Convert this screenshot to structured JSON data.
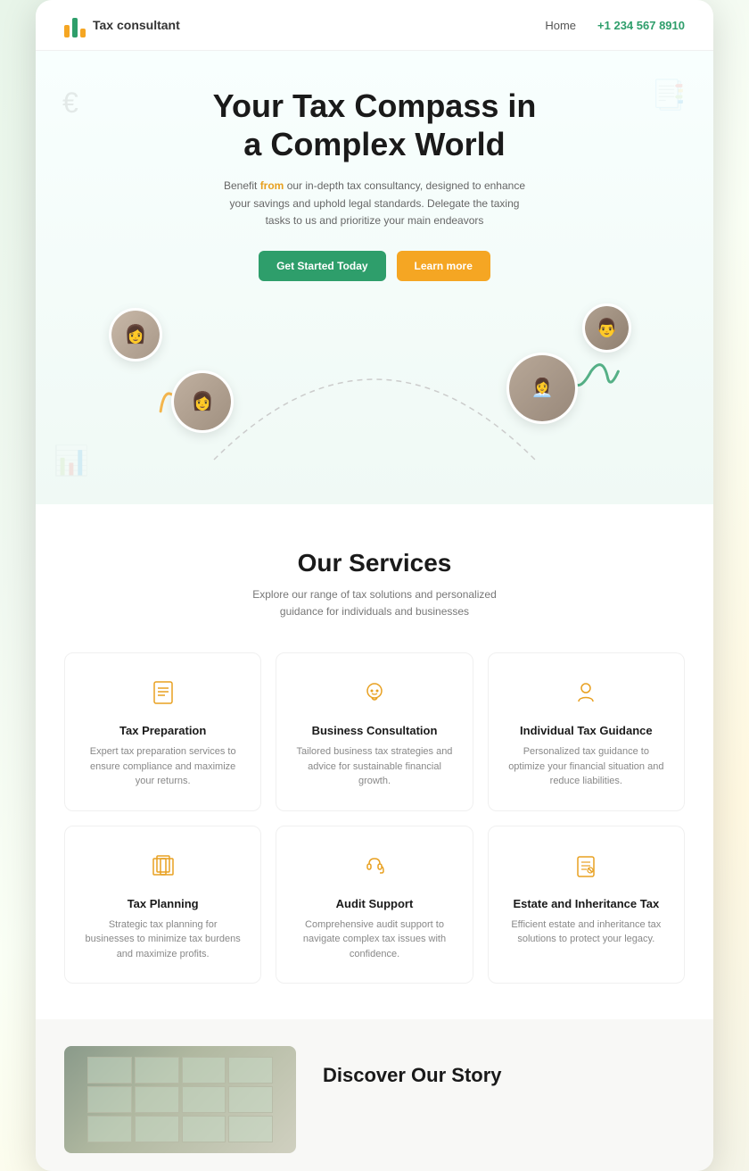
{
  "brand": {
    "name": "Tax consultant"
  },
  "nav": {
    "home_label": "Home",
    "phone": "+1 234 567 8910"
  },
  "hero": {
    "title_line1": "Your Tax Compass in",
    "title_line2": "a Complex World",
    "subtitle": "Benefit from our in-depth tax consultancy, designed to enhance your savings and uphold legal standards. Delegate the taxing tasks to us and prioritize your main endeavors",
    "subtitle_highlight": "from",
    "cta_primary": "Get Started Today",
    "cta_secondary": "Learn more"
  },
  "services": {
    "section_title": "Our Services",
    "section_subtitle": "Explore our range of tax solutions and personalized guidance for individuals and businesses",
    "items": [
      {
        "name": "Tax Preparation",
        "desc": "Expert tax preparation services to ensure compliance and maximize your returns.",
        "icon": "📋"
      },
      {
        "name": "Business Consultation",
        "desc": "Tailored business tax strategies and advice for sustainable financial growth.",
        "icon": "💬"
      },
      {
        "name": "Individual Tax Guidance",
        "desc": "Personalized tax guidance to optimize your financial situation and reduce liabilities.",
        "icon": "👤"
      },
      {
        "name": "Tax Planning",
        "desc": "Strategic tax planning for businesses to minimize tax burdens and maximize profits.",
        "icon": "📚"
      },
      {
        "name": "Audit Support",
        "desc": "Comprehensive audit support to navigate complex tax issues with confidence.",
        "icon": "🎧"
      },
      {
        "name": "Estate and Inheritance Tax",
        "desc": "Efficient estate and inheritance tax solutions to protect your legacy.",
        "icon": "📄"
      }
    ]
  },
  "discover": {
    "title_line1": "Discover Our Story"
  }
}
